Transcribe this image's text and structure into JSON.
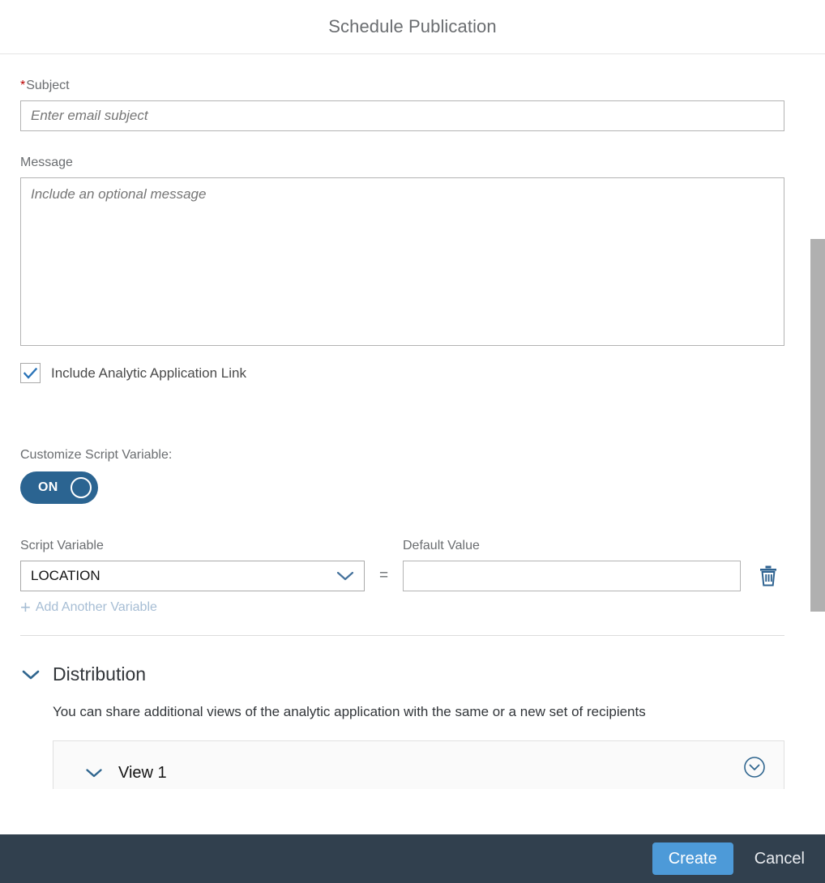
{
  "dialog": {
    "title": "Schedule Publication"
  },
  "form": {
    "subject": {
      "label": "Subject",
      "required_marker": "*",
      "placeholder": "Enter email subject",
      "value": ""
    },
    "message": {
      "label": "Message",
      "placeholder": "Include an optional message",
      "value": ""
    },
    "include_link": {
      "label": "Include Analytic Application Link",
      "checked": true,
      "icon": "checkmark-icon"
    },
    "customize_script_variable": {
      "label": "Customize Script Variable:",
      "toggle_state": "ON"
    },
    "variables": {
      "script_variable_header": "Script Variable",
      "default_value_header": "Default Value",
      "equals": "=",
      "rows": [
        {
          "script_variable": "LOCATION",
          "default_value": "",
          "dropdown_icon": "chevron-down-icon",
          "delete_icon": "trash-icon"
        }
      ],
      "add_another": {
        "plus": "+",
        "label": "Add Another Variable"
      }
    }
  },
  "distribution": {
    "chevron_icon": "chevron-down-icon",
    "title": "Distribution",
    "description": "You can share additional views of the analytic application with the same or a new set of recipients",
    "views": [
      {
        "title": "View 1",
        "expand_icon": "chevron-down-circle-icon",
        "chevron_icon": "chevron-down-icon"
      }
    ]
  },
  "footer": {
    "create_label": "Create",
    "cancel_label": "Cancel"
  },
  "colors": {
    "accent_blue": "#4d9ad8",
    "toggle_on": "#2b6491",
    "footer_bg": "#31404e",
    "required_red": "#bb0000",
    "link_blue": "#a6bdd4",
    "icon_blue": "#3c6e99"
  }
}
